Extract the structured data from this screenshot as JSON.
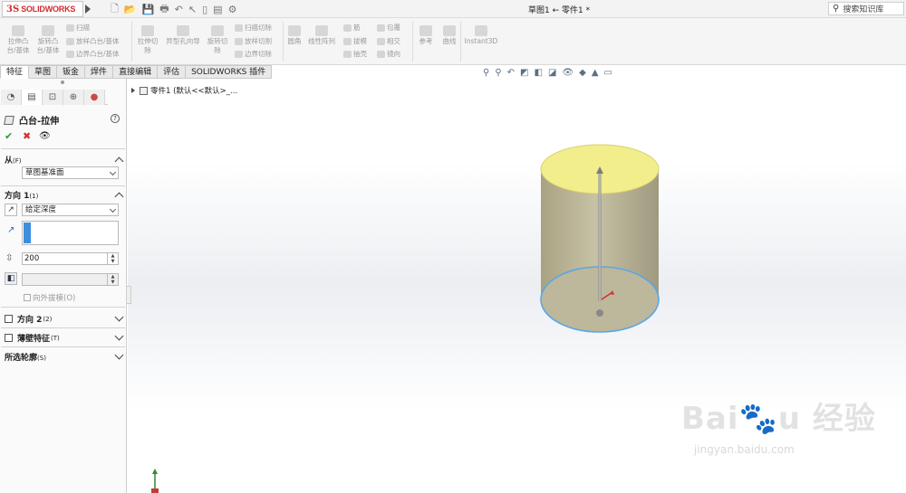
{
  "app": {
    "logo_prefix": "3S",
    "logo_text": "SOLIDWORKS"
  },
  "title_bar": {
    "document_title": "草图1 ← 零件1 *",
    "search_placeholder": "搜索知识库"
  },
  "ribbon": {
    "extrude_boss": [
      "拉伸凸",
      "台/基体"
    ],
    "revolve_boss": [
      "旋转凸",
      "台/基体"
    ],
    "sweep": "扫描",
    "loft": "放样凸台/基体",
    "boundary": "边界凸台/基体",
    "extrude_cut": [
      "拉伸切",
      "除"
    ],
    "hole_wizard": [
      "异型孔向导",
      ""
    ],
    "revolve_cut": [
      "旋转切",
      "除"
    ],
    "swept_cut": "扫描切除",
    "lofted_cut": "放样切割",
    "boundary_cut": "边界切除",
    "fillet": "圆角",
    "linear_pattern": "线性阵列",
    "rib": "筋",
    "draft": "拔模",
    "shell": "抽壳",
    "wrap": "包覆",
    "intersect": "相交",
    "mirror": "镜向",
    "reference": "参考",
    "curves": "曲线",
    "instant3d": "Instant3D"
  },
  "tabs": [
    "特征",
    "草图",
    "钣金",
    "焊件",
    "直接编辑",
    "评估",
    "SOLIDWORKS 插件"
  ],
  "panel": {
    "title": "凸台-拉伸",
    "help": "?",
    "ok": "✔",
    "cancel": "✖",
    "eye": "👁",
    "from": {
      "label": "从",
      "key": "(F)",
      "value": "草图基准面"
    },
    "direction1": {
      "label": "方向 1",
      "key": "(1)",
      "end_condition": "给定深度",
      "depth": "200",
      "draft_outward": "向外拔模(O)"
    },
    "direction2": {
      "label": "方向 2",
      "key": "(2)"
    },
    "thin_feature": {
      "label": "薄壁特征",
      "key": "(T)"
    },
    "selected_contours": {
      "label": "所选轮廓",
      "key": "(S)"
    }
  },
  "tree": {
    "item": "零件1 (默认<<默认>_..."
  },
  "watermark": {
    "brand": "Bai🐾u 经验",
    "url": "jingyan.baidu.com"
  },
  "model": {
    "top_face_color": "#f2ee8c",
    "side_color": "#b9b395",
    "edge_color": "#5aa6e6",
    "arrow_color": "#9a9a9a"
  }
}
